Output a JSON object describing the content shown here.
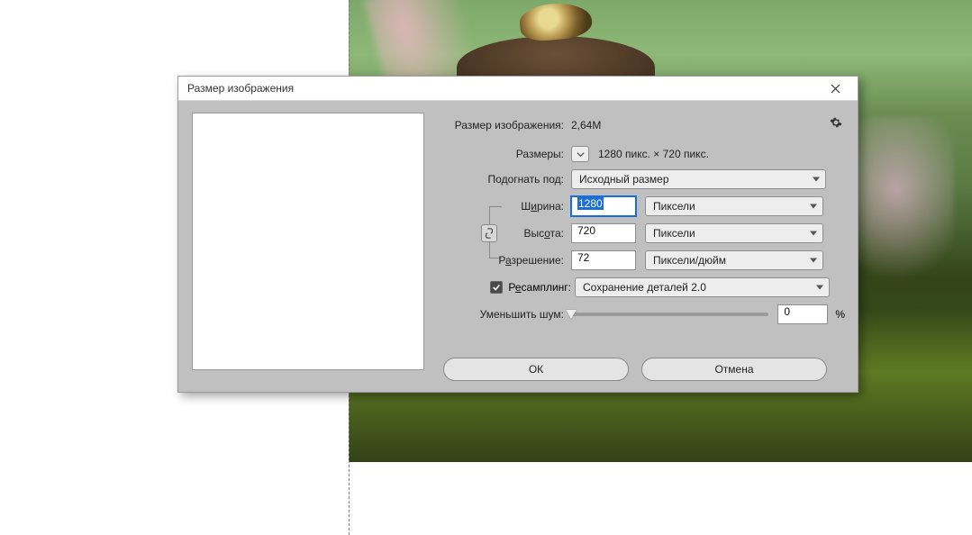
{
  "dialog": {
    "title": "Размер изображения",
    "size_label": "Размер изображения:",
    "size_value": "2,64M",
    "dims_label": "Размеры:",
    "dims_value": "1280 пикс. × 720 пикс.",
    "fit_label": "Подогнать под:",
    "fit_value": "Исходный размер",
    "width_label": "Ширина:",
    "width_value": "1280",
    "width_unit": "Пиксели",
    "height_label": "Высота:",
    "height_value": "720",
    "height_unit": "Пиксели",
    "res_label": "Разрешение:",
    "res_value": "72",
    "res_unit": "Пиксели/дюйм",
    "resample_label_pre": "Р",
    "resample_label_u": "е",
    "resample_label_post": "самплинг:",
    "resample_value": "Сохранение деталей 2.0",
    "noise_label": "Уменьшить шум:",
    "noise_value": "0",
    "pct": "%",
    "width_label_pre": "Ш",
    "width_label_u": "и",
    "width_label_post": "рина:",
    "height_label_pre": "Выс",
    "height_label_u": "о",
    "height_label_post": "та:",
    "res_label_pre": "Р",
    "res_label_u": "а",
    "res_label_post": "зрешение:"
  },
  "buttons": {
    "ok": "ОК",
    "cancel": "Отмена"
  },
  "colors": {
    "dialog_bg": "#c0c0c0",
    "accent": "#1a6fd6"
  }
}
